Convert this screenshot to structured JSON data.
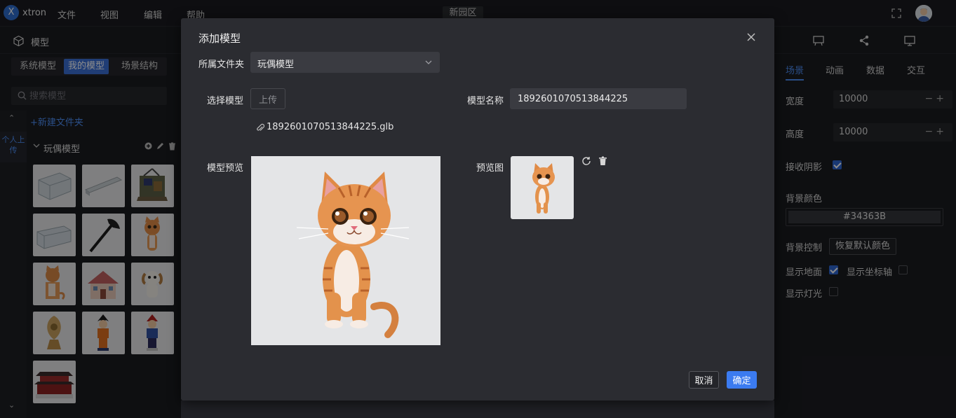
{
  "app": {
    "logo_letter": "X",
    "name": "xtron",
    "project": "新园区"
  },
  "menu": [
    "文件",
    "视图",
    "编辑",
    "帮助"
  ],
  "left_panel": {
    "title": "模型",
    "tabs": [
      "系统模型",
      "我的模型",
      "场景结构"
    ],
    "active_tab": "我的模型",
    "search_placeholder": "搜索模型",
    "new_folder": "+新建文件夹",
    "side_personal": "个人上传",
    "folder_name": "玩偶模型"
  },
  "right_panel": {
    "tabs": [
      "场景",
      "动画",
      "数据",
      "交互"
    ],
    "active_tab": "场景",
    "width_label": "宽度",
    "width_value": "10000",
    "height_label": "高度",
    "height_value": "10000",
    "receive_shadow_label": "接收阴影",
    "receive_shadow": true,
    "bg_color_label": "背景颜色",
    "bg_color_value": "#34363B",
    "bg_control_label": "背景控制",
    "reset_color_button": "恢复默认颜色",
    "show_ground_label": "显示地面",
    "show_ground": true,
    "show_axis_label": "显示坐标轴",
    "show_axis": false,
    "show_light_label": "显示灯光",
    "show_light": false,
    "stepper_symbols": "−+"
  },
  "modal": {
    "title": "添加模型",
    "folder_label": "所属文件夹",
    "folder_value": "玩偶模型",
    "select_model_label": "选择模型",
    "upload_button": "上传",
    "file_name": "1892601070513844225.glb",
    "model_name_label": "模型名称",
    "model_name_value": "1892601070513844225",
    "model_preview_label": "模型预览",
    "preview_image_label": "预览图",
    "cancel_button": "取消",
    "ok_button": "确定"
  },
  "colors": {
    "accent": "#3b7bf0",
    "panel": "#2b2c31",
    "background": "#1b1c20"
  }
}
